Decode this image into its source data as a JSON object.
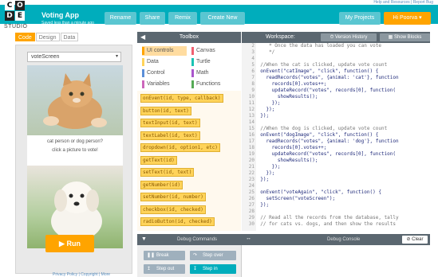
{
  "top_links": "Help and Resources | Report Bug",
  "header": {
    "logo_letters": [
      "C",
      "O",
      "D",
      "E"
    ],
    "studio": "STUDIO",
    "app_name": "Voting App",
    "app_subtitle": "Saved less than a minute ago",
    "buttons": [
      "Rename",
      "Share",
      "Remix",
      "Create New"
    ],
    "my_projects": "My Projects",
    "user": "Hi Poorva ▾"
  },
  "mode_tabs": [
    "Code",
    "Design",
    "Data"
  ],
  "app_preview": {
    "screen_select": "voteScreen",
    "prompt_line1": "cat person or dog person?",
    "prompt_line2": "click a picture to vote!",
    "run_label": "Run"
  },
  "footer_links": "Privacy Policy | Copyright | More",
  "toolbox": {
    "title": "Toolbox",
    "categories": [
      {
        "label": "UI controls",
        "color": "#ffa400"
      },
      {
        "label": "Canvas",
        "color": "#f06070"
      },
      {
        "label": "Data",
        "color": "#ffd35a"
      },
      {
        "label": "Turtle",
        "color": "#19c3b4"
      },
      {
        "label": "Control",
        "color": "#5b8fd8"
      },
      {
        "label": "Math",
        "color": "#aa55cc"
      },
      {
        "label": "Variables",
        "color": "#cc66bb"
      },
      {
        "label": "Functions",
        "color": "#55aa55"
      }
    ],
    "blocks": [
      "onEvent(id, type, callback)",
      "button(id, text)",
      "textInput(id, text)",
      "textLabel(id, text)",
      "dropdown(id, option1, etc)",
      "getText(id)",
      "setText(id, text)",
      "getNumber(id)",
      "setNumber(id, number)",
      "checkbox(id, checked)",
      "radioButton(id, checked)"
    ]
  },
  "workspace": {
    "title": "Workspace:",
    "version_history": "Version History",
    "show_blocks": "Show Blocks",
    "code": [
      {
        "n": "2",
        "t": "   * Once the data has loaded you can vote",
        "c": true
      },
      {
        "n": "3",
        "t": "   */",
        "c": true
      },
      {
        "n": "4",
        "t": "",
        "c": false
      },
      {
        "n": "5",
        "t": "//When the cat is clicked, update vote count",
        "c": true
      },
      {
        "n": "6",
        "t": "onEvent(\"catImage\", \"click\", function() {",
        "c": false
      },
      {
        "n": "7",
        "t": "  readRecords(\"votes\", {animal: 'cat'}, function",
        "c": false
      },
      {
        "n": "8",
        "t": "    records[0].votes++;",
        "c": false
      },
      {
        "n": "9",
        "t": "    updateRecord(\"votes\", records[0], function(",
        "c": false
      },
      {
        "n": "10",
        "t": "      showResults();",
        "c": false
      },
      {
        "n": "11",
        "t": "    });",
        "c": false
      },
      {
        "n": "12",
        "t": "  });",
        "c": false
      },
      {
        "n": "13",
        "t": "});",
        "c": false
      },
      {
        "n": "14",
        "t": "",
        "c": false
      },
      {
        "n": "15",
        "t": "//When the dog is clicked, update vote count",
        "c": true
      },
      {
        "n": "16",
        "t": "onEvent(\"dogImage\", \"click\", function() {",
        "c": false
      },
      {
        "n": "17",
        "t": "  readRecords(\"votes\", {animal: 'dog'}, function",
        "c": false
      },
      {
        "n": "18",
        "t": "    records[0].votes++;",
        "c": false
      },
      {
        "n": "19",
        "t": "    updateRecord(\"votes\", records[0], function(",
        "c": false
      },
      {
        "n": "20",
        "t": "      showResults();",
        "c": false
      },
      {
        "n": "21",
        "t": "    });",
        "c": false
      },
      {
        "n": "22",
        "t": "  });",
        "c": false
      },
      {
        "n": "23",
        "t": "});",
        "c": false
      },
      {
        "n": "24",
        "t": "",
        "c": false
      },
      {
        "n": "25",
        "t": "onEvent(\"voteAgain\", \"click\", function() {",
        "c": false
      },
      {
        "n": "26",
        "t": "  setScreen(\"voteScreen\");",
        "c": false
      },
      {
        "n": "27",
        "t": "});",
        "c": false
      },
      {
        "n": "28",
        "t": "",
        "c": false
      },
      {
        "n": "29",
        "t": "// Read all the records from the database, tally",
        "c": true
      },
      {
        "n": "30",
        "t": "// for cats vs. dogs, and then show the results",
        "c": true
      }
    ]
  },
  "debug": {
    "commands_title": "Debug Commands",
    "console_title": "Debug Console",
    "clear": "Clear",
    "buttons": [
      "Break",
      "Step over",
      "Step out",
      "Step in"
    ]
  }
}
